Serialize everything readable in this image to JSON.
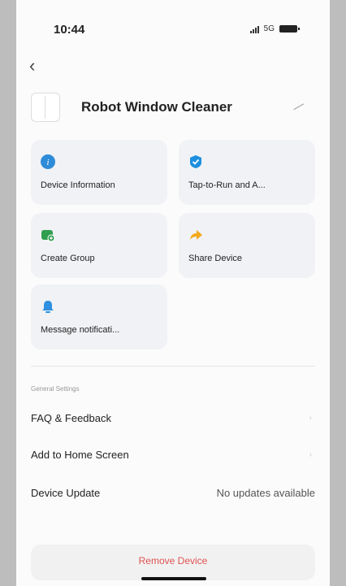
{
  "status_bar": {
    "time": "10:44",
    "network": "5G"
  },
  "device": {
    "name": "Robot Window Cleaner"
  },
  "tiles": [
    {
      "label": "Device Information",
      "color": "#2e8bd8"
    },
    {
      "label": "Tap-to-Run and A...",
      "color": "#1d8fe0"
    },
    {
      "label": "Create Group",
      "color": "#2f9e4e"
    },
    {
      "label": "Share Device",
      "color": "#f2a91d"
    },
    {
      "label": "Message notificati...",
      "color": "#2f8fe0"
    }
  ],
  "settings": {
    "section_title": "General Settings",
    "items": [
      {
        "label": "FAQ & Feedback"
      },
      {
        "label": "Add to Home Screen"
      },
      {
        "label": "Device Update",
        "value": "No updates available"
      }
    ]
  },
  "remove_label": "Remove Device"
}
